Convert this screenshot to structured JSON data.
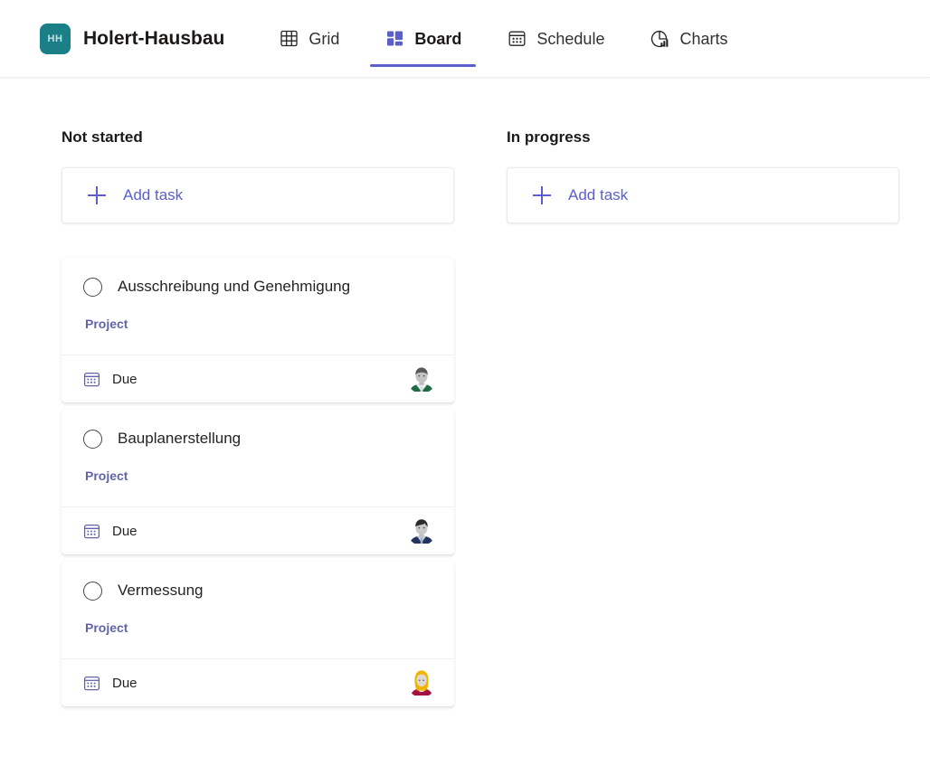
{
  "header": {
    "badge_text": "HH",
    "badge_color": "#1a7f86",
    "title": "Holert-Hausbau",
    "accent_color": "#5b5fc7",
    "tabs": [
      {
        "label": "Grid",
        "icon": "grid-icon",
        "active": false
      },
      {
        "label": "Board",
        "icon": "board-icon",
        "active": true
      },
      {
        "label": "Schedule",
        "icon": "schedule-icon",
        "active": false
      },
      {
        "label": "Charts",
        "icon": "charts-icon",
        "active": false
      }
    ]
  },
  "board": {
    "columns": [
      {
        "title": "Not started",
        "add_task_label": "Add task",
        "add_icon": "plus-icon",
        "cards": [
          {
            "title": "Ausschreibung und Genehmigung",
            "label": "Project",
            "label_color": "#6264a7",
            "due_label": "Due",
            "due_icon": "calendar-icon",
            "avatar": "avatar-man-green"
          },
          {
            "title": "Bauplanerstellung",
            "label": "Project",
            "label_color": "#6264a7",
            "due_label": "Due",
            "due_icon": "calendar-icon",
            "avatar": "avatar-man-navy"
          },
          {
            "title": "Vermessung",
            "label": "Project",
            "label_color": "#6264a7",
            "due_label": "Due",
            "due_icon": "calendar-icon",
            "avatar": "avatar-woman-blonde"
          }
        ]
      },
      {
        "title": "In progress",
        "add_task_label": "Add task",
        "add_icon": "plus-icon",
        "cards": []
      }
    ]
  }
}
